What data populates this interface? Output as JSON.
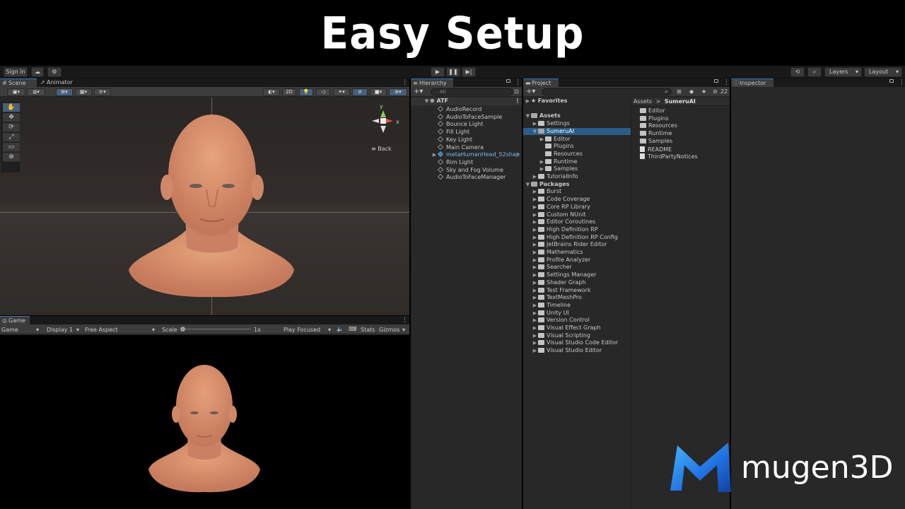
{
  "banner": {
    "title": "Easy Setup"
  },
  "toolbar": {
    "sign_in": "Sign in",
    "layers": "Layers",
    "layout": "Layout"
  },
  "scene": {
    "tabs": {
      "scene": "Scene",
      "animator": "Animator"
    },
    "mode_2d": "2D",
    "gizmo": {
      "y": "y",
      "x": "x",
      "back": "Back"
    }
  },
  "game": {
    "tab": "Game",
    "display_mode": "Game",
    "display": "Display 1",
    "aspect": "Free Aspect",
    "scale_label": "Scale",
    "scale_value": "1x",
    "play_focused": "Play Focused",
    "stats": "Stats",
    "gizmos": "Gizmos"
  },
  "hierarchy": {
    "tab": "Hierarchy",
    "search_placeholder": "All",
    "scene_name": "ATF",
    "items": [
      "AudioRecord",
      "AudioToFaceSample",
      "Bounce Light",
      "Fill Light",
      "Key Light",
      "Main Camera",
      "metaHumanHead_52shap",
      "Rim Light",
      "Sky and Fog Volume",
      "AudioToFaceManager"
    ]
  },
  "project": {
    "tab": "Project",
    "count": "22",
    "favorites": "Favorites",
    "assets": "Assets",
    "asset_tree": [
      "Settings",
      "SumeruAI",
      "Editor",
      "Plugins",
      "Resources",
      "Runtime",
      "Samples",
      "TutorialInfo"
    ],
    "packages": "Packages",
    "package_items": [
      "Burst",
      "Code Coverage",
      "Core RP Library",
      "Custom NUnit",
      "Editor Coroutines",
      "High Definition RP",
      "High Definition RP Config",
      "JetBrains Rider Editor",
      "Mathematics",
      "Profile Analyzer",
      "Searcher",
      "Settings Manager",
      "Shader Graph",
      "Test Framework",
      "TextMeshPro",
      "Timeline",
      "Unity UI",
      "Version Control",
      "Visual Effect Graph",
      "Visual Scripting",
      "Visual Studio Code Editor",
      "Visual Studio Editor"
    ],
    "breadcrumb": {
      "root": "Assets",
      "sep": ">",
      "current": "SumeruAI"
    },
    "contents": [
      "Editor",
      "Plugins",
      "Resources",
      "Runtime",
      "Samples",
      "README",
      "ThirdPartyNotices"
    ]
  },
  "inspector": {
    "tab": "Inspector"
  },
  "logo": {
    "text": "mugen3D"
  },
  "colors": {
    "accent": "#3a79bb",
    "selection": "#2c5d87",
    "skin": "#d9916a"
  }
}
